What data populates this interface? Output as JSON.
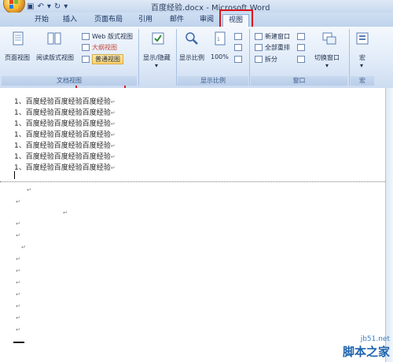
{
  "window": {
    "title": "百度经验.docx - Microsoft Word"
  },
  "tabs": [
    {
      "label": "开始"
    },
    {
      "label": "插入"
    },
    {
      "label": "页面布局"
    },
    {
      "label": "引用"
    },
    {
      "label": "邮件"
    },
    {
      "label": "审阅"
    },
    {
      "label": "视图"
    }
  ],
  "ribbon": {
    "doc_views": {
      "print_layout": "页面视图",
      "full_screen_reading": "阅读版式视图",
      "web_layout": "Web 版式视图",
      "outline": "大纲视图",
      "draft": "普通视图",
      "group_label": "文档视图"
    },
    "show_hide": {
      "label": "显示/隐藏"
    },
    "zoom": {
      "zoom_label": "显示比例",
      "zoom_100": "100%",
      "group_label": "显示比例"
    },
    "window": {
      "new_window": "新建窗口",
      "arrange_all": "全部重排",
      "split": "拆分",
      "switch_windows": "切换窗口",
      "group_label": "窗口"
    },
    "macros": {
      "label": "宏",
      "group_label": "宏"
    }
  },
  "document": {
    "lines": [
      "1、百度经验百度经验百度经验",
      "1、百度经验百度经验百度经验",
      "1、百度经验百度经验百度经验",
      "1、百度经验百度经验百度经验",
      "1、百度经验百度经验百度经验",
      "1、百度经验百度经验百度经验",
      "1、百度经验百度经验百度经验"
    ],
    "paragraph_mark": "↵"
  },
  "watermark": {
    "site": "jb51.net",
    "brand": "脚本之家"
  },
  "colors": {
    "highlight_box": "#d8151c",
    "ribbon_blue": "#dfeaf8"
  }
}
